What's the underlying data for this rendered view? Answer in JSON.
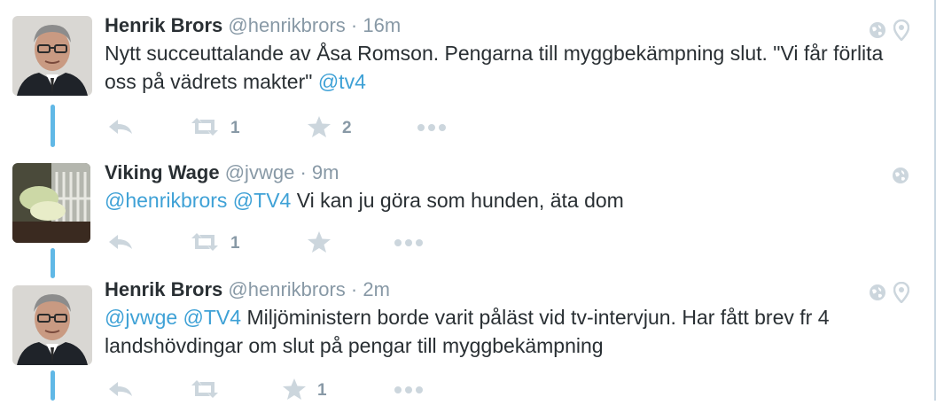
{
  "tweets": [
    {
      "name": "Henrik Brors",
      "handle": "@henrikbrors",
      "sep": "·",
      "time": "16m",
      "text": [
        {
          "t": "Nytt succeuttalande av Åsa Romson. Pengarna till myggbekämpning slut. \"Vi får förlita oss på vädrets makter\" ",
          "mention": false
        },
        {
          "t": "@tv4",
          "mention": true
        }
      ],
      "retweets": "1",
      "favorites": "2",
      "icons": [
        "globe-icon",
        "location-pin-icon"
      ]
    },
    {
      "name": "Viking Wage",
      "handle": "@jvwge",
      "sep": "·",
      "time": "9m",
      "text": [
        {
          "t": "@henrikbrors",
          "mention": true
        },
        {
          "t": " ",
          "mention": false
        },
        {
          "t": "@TV4",
          "mention": true
        },
        {
          "t": " Vi kan ju göra som hunden, äta dom",
          "mention": false
        }
      ],
      "retweets": "1",
      "favorites": "",
      "icons": [
        "globe-icon"
      ]
    },
    {
      "name": "Henrik Brors",
      "handle": "@henrikbrors",
      "sep": "·",
      "time": "2m",
      "text": [
        {
          "t": "@jvwge",
          "mention": true
        },
        {
          "t": " ",
          "mention": false
        },
        {
          "t": "@TV4",
          "mention": true
        },
        {
          "t": " Miljöministern borde varit påläst vid tv-intervjun. Har fått brev fr 4 landshövdingar om slut på pengar till myggbekämpning",
          "mention": false
        }
      ],
      "retweets": "",
      "favorites": "1",
      "icons": [
        "globe-icon",
        "location-pin-icon"
      ]
    }
  ],
  "colors": {
    "name": "#292f33",
    "muted": "#8899a6",
    "mention": "#3ea1d6",
    "thread_line": "#61b8e6",
    "icon": "#ccd6dd"
  }
}
